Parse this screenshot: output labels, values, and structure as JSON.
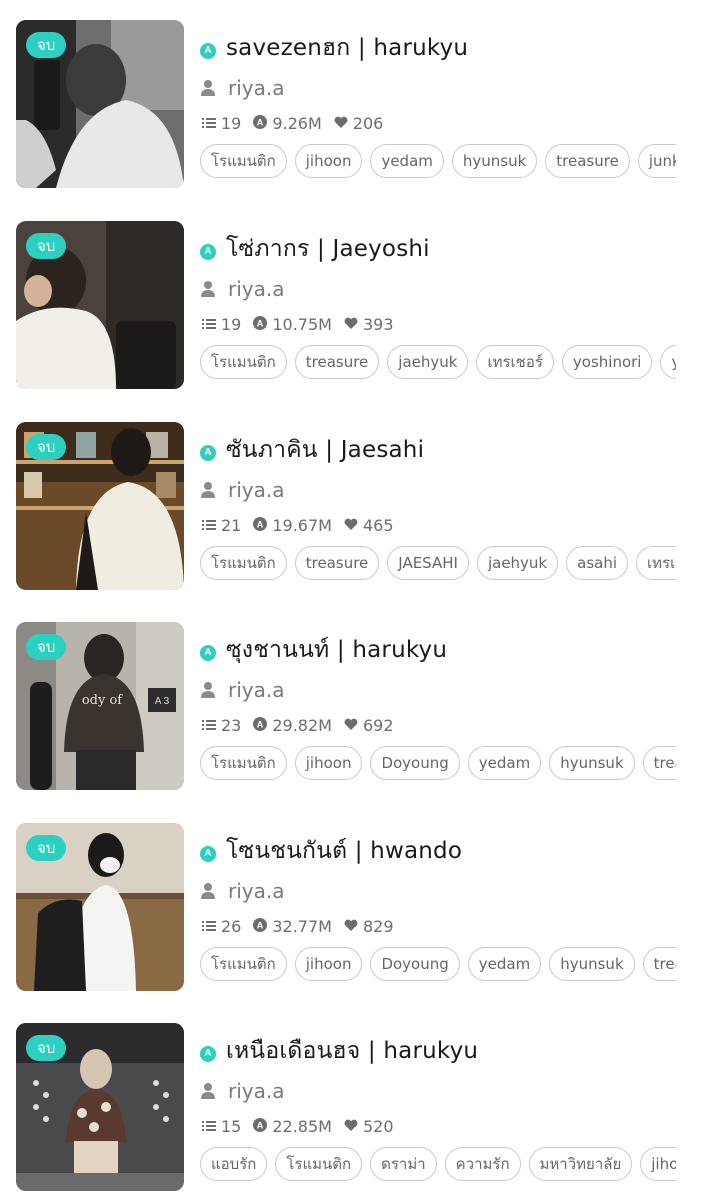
{
  "colors": {
    "accent": "#2ccfc0",
    "text": "#1a1a1a",
    "muted": "#7a7a7a",
    "tag_border": "#c9c9c9"
  },
  "icons": {
    "status": "A-circle-icon",
    "author": "user-icon",
    "chapters": "list-icon",
    "views": "eye-icon",
    "likes": "heart-icon"
  },
  "novels": [
    {
      "badge": "จบ",
      "title": "savezenฮก | harukyu",
      "author": "riya.a",
      "chapters": "19",
      "views": "9.26M",
      "likes": "206",
      "tags": [
        "โรแมนติก",
        "jihoon",
        "yedam",
        "hyunsuk",
        "treasure",
        "junkyu"
      ]
    },
    {
      "badge": "จบ",
      "title": "โซ่ภากร | Jaeyoshi",
      "author": "riya.a",
      "chapters": "19",
      "views": "10.75M",
      "likes": "393",
      "tags": [
        "โรแมนติก",
        "treasure",
        "jaehyuk",
        "เทรเชอร์",
        "yoshinori",
        "yoshi"
      ]
    },
    {
      "badge": "จบ",
      "title": "ซันภาคิน | Jaesahi",
      "author": "riya.a",
      "chapters": "21",
      "views": "19.67M",
      "likes": "465",
      "tags": [
        "โรแมนติก",
        "treasure",
        "JAESAHI",
        "jaehyuk",
        "asahi",
        "เทรเชอร์"
      ]
    },
    {
      "badge": "จบ",
      "title": "ซุงชานนท์ | harukyu",
      "author": "riya.a",
      "chapters": "23",
      "views": "29.82M",
      "likes": "692",
      "tags": [
        "โรแมนติก",
        "jihoon",
        "Doyoung",
        "yedam",
        "hyunsuk",
        "treasure"
      ]
    },
    {
      "badge": "จบ",
      "title": "โซนชนกันต์ | hwando",
      "author": "riya.a",
      "chapters": "26",
      "views": "32.77M",
      "likes": "829",
      "tags": [
        "โรแมนติก",
        "jihoon",
        "Doyoung",
        "yedam",
        "hyunsuk",
        "treasure"
      ]
    },
    {
      "badge": "จบ",
      "title": "เหนือเดือนฮจ | harukyu",
      "author": "riya.a",
      "chapters": "15",
      "views": "22.85M",
      "likes": "520",
      "tags": [
        "แอบรัก",
        "โรแมนติก",
        "ดราม่า",
        "ความรัก",
        "มหาวิทยาลัย",
        "jihoon"
      ]
    }
  ]
}
